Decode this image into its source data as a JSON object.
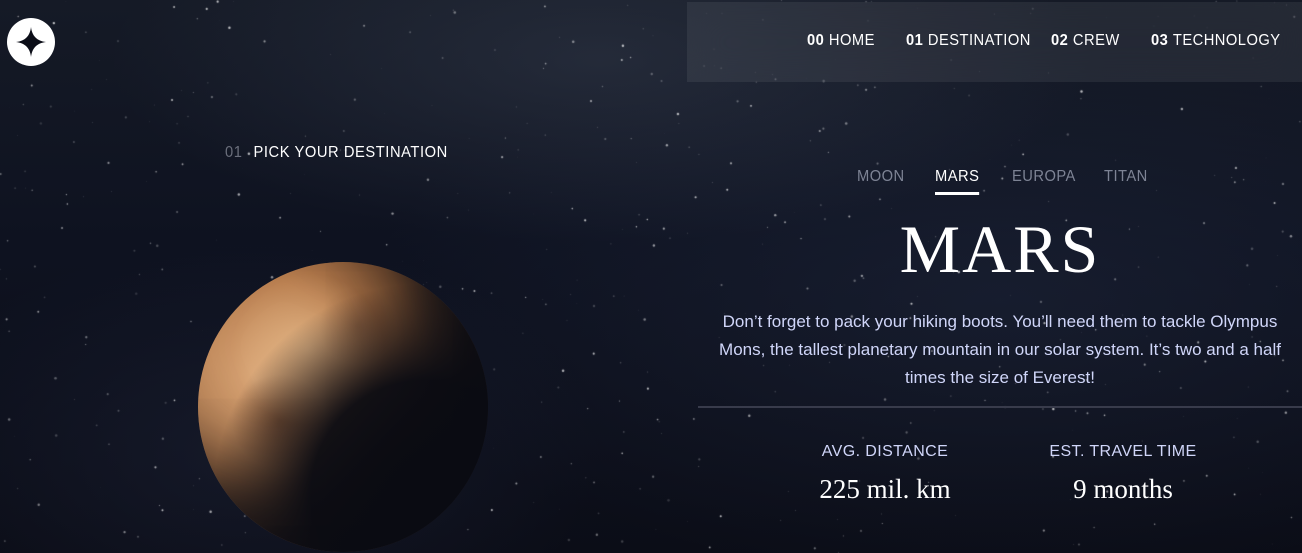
{
  "nav": {
    "items": [
      {
        "num": "00",
        "label": "HOME"
      },
      {
        "num": "01",
        "label": "DESTINATION"
      },
      {
        "num": "02",
        "label": "CREW"
      },
      {
        "num": "03",
        "label": "TECHNOLOGY"
      }
    ]
  },
  "page": {
    "heading_num": "01",
    "heading": "PICK YOUR DESTINATION"
  },
  "destinations": {
    "tabs": [
      "MOON",
      "MARS",
      "EUROPA",
      "TITAN"
    ],
    "active_tab": "MARS"
  },
  "planet": {
    "name": "MARS",
    "description": "Don’t forget to pack your hiking boots. You’ll need them to tackle Olympus Mons, the tallest planetary mountain in our solar system. It’s two and a half times the size of Everest!",
    "distance_label": "AVG. DISTANCE",
    "distance_value": "225 mil. km",
    "travel_label": "EST. TRAVEL TIME",
    "travel_value": "9 months"
  },
  "icons": {
    "logo": "star-logo-icon",
    "planet_image": "mars-planet-image"
  },
  "colors": {
    "background": "#0b0d17",
    "text_light": "#d0d6f9",
    "white": "#ffffff"
  }
}
